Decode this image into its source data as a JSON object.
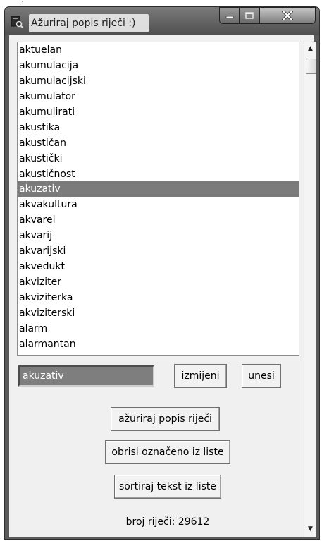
{
  "window": {
    "title": "Ažuriraj popis riječi :)"
  },
  "word_list": {
    "items": [
      "aktuelan",
      "akumulacija",
      "akumulacijski",
      "akumulator",
      "akumulirati",
      "akustika",
      "akustičan",
      "akustički",
      "akustičnost",
      "akuzativ",
      "akvakultura",
      "akvarel",
      "akvarij",
      "akvarijski",
      "akvedukt",
      "akviziter",
      "akviziterka",
      "akviziterski",
      "alarm",
      "alarmantan"
    ],
    "selected": "akuzativ"
  },
  "form": {
    "entry_value": "akuzativ",
    "izmijeni_label": "izmijeni",
    "unesi_label": "unesi",
    "azuriraj_label": "ažuriraj popis riječi",
    "obrisi_label": "obrisi označeno iz liste",
    "sortiraj_label": "sortiraj tekst iz liste",
    "count_text": "broj riječi: 29612"
  }
}
